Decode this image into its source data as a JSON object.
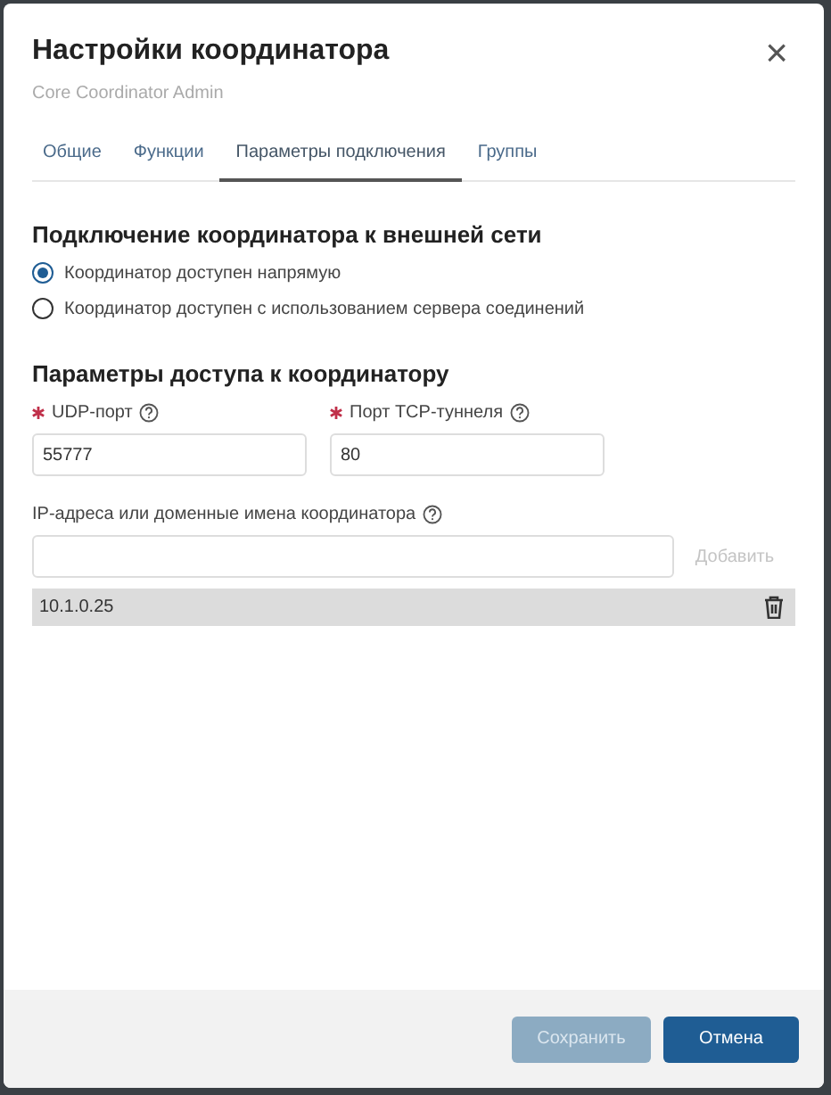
{
  "dialog": {
    "title": "Настройки координатора",
    "subtitle": "Core Coordinator Admin",
    "close": "×"
  },
  "tabs": [
    {
      "label": "Общие",
      "selected": false
    },
    {
      "label": "Функции",
      "selected": false
    },
    {
      "label": "Параметры подключения",
      "selected": true
    },
    {
      "label": "Группы",
      "selected": false
    }
  ],
  "connection": {
    "heading": "Подключение координатора к внешней сети",
    "options": [
      {
        "label": "Координатор доступен напрямую",
        "selected": true
      },
      {
        "label": "Координатор доступен с использованием сервера соединений",
        "selected": false
      }
    ]
  },
  "access": {
    "heading": "Параметры доступа к координатору",
    "fields": [
      {
        "label": "UDP-порт",
        "required": true,
        "value": "55777"
      },
      {
        "label": "Порт TCP-туннеля",
        "required": true,
        "value": "80"
      }
    ]
  },
  "addresses": {
    "label": "IP-адреса или доменные имена координатора",
    "add_button": {
      "label": "Добавить",
      "disabled": true
    },
    "items": [
      "10.1.0.25"
    ]
  },
  "footer": [
    {
      "label": "Сохранить",
      "kind": "primary",
      "disabled": true
    },
    {
      "label": "Отмена",
      "kind": "primary",
      "disabled": false
    }
  ]
}
